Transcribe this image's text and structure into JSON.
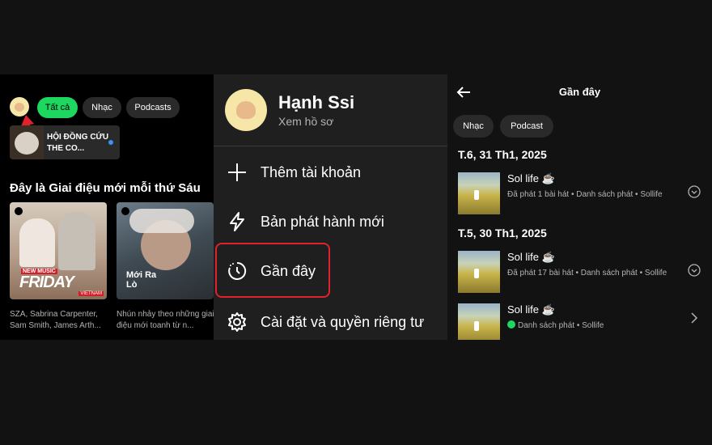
{
  "home": {
    "chips": [
      "Tất cả",
      "Nhạc",
      "Podcasts"
    ],
    "shortcut_title": "HỘI ĐỒNG CỨU THE CO...",
    "section_title": "Đây là Giai điệu mới mỗi thứ Sáu",
    "cards": [
      {
        "label_small": "NEW MUSIC",
        "label_big": "FRIDAY",
        "label_country": "VIETNAM",
        "desc": "SZA, Sabrina Carpenter, Sam Smith, James Arth..."
      },
      {
        "label_big": "Mới Ra Lò",
        "desc": "Nhún nhảy theo những giai điệu mới toanh từ n..."
      }
    ]
  },
  "menu": {
    "name": "Hạnh Ssi",
    "sub": "Xem hồ sơ",
    "items": [
      {
        "label": "Thêm tài khoản",
        "icon": "plus-icon"
      },
      {
        "label": "Bản phát hành mới",
        "icon": "lightning-icon"
      },
      {
        "label": "Gần đây",
        "icon": "clock-history-icon"
      },
      {
        "label": "Cài đặt và quyền riêng tư",
        "icon": "gear-icon"
      }
    ]
  },
  "recent": {
    "title": "Gần đây",
    "chips": [
      "Nhạc",
      "Podcast"
    ],
    "groups": [
      {
        "date": "T.6, 31 Th1, 2025",
        "items": [
          {
            "name": "Sol life ☕",
            "meta": "Đã phát 1 bài hát • Danh sách phát • Sollife",
            "trail": "chevron-down-circle-icon"
          }
        ]
      },
      {
        "date": "T.5, 30 Th1, 2025",
        "items": [
          {
            "name": "Sol life ☕",
            "meta": "Đã phát 17 bài hát • Danh sách phát • Sollife",
            "trail": "chevron-down-circle-icon"
          },
          {
            "name": "Sol life ☕",
            "meta": "Danh sách phát • Sollife",
            "trail": "chevron-right-icon"
          }
        ]
      }
    ]
  },
  "colors": {
    "accent_green": "#1ed760",
    "highlight_red": "#e1222c",
    "menu_bg": "#1f1f1f"
  }
}
